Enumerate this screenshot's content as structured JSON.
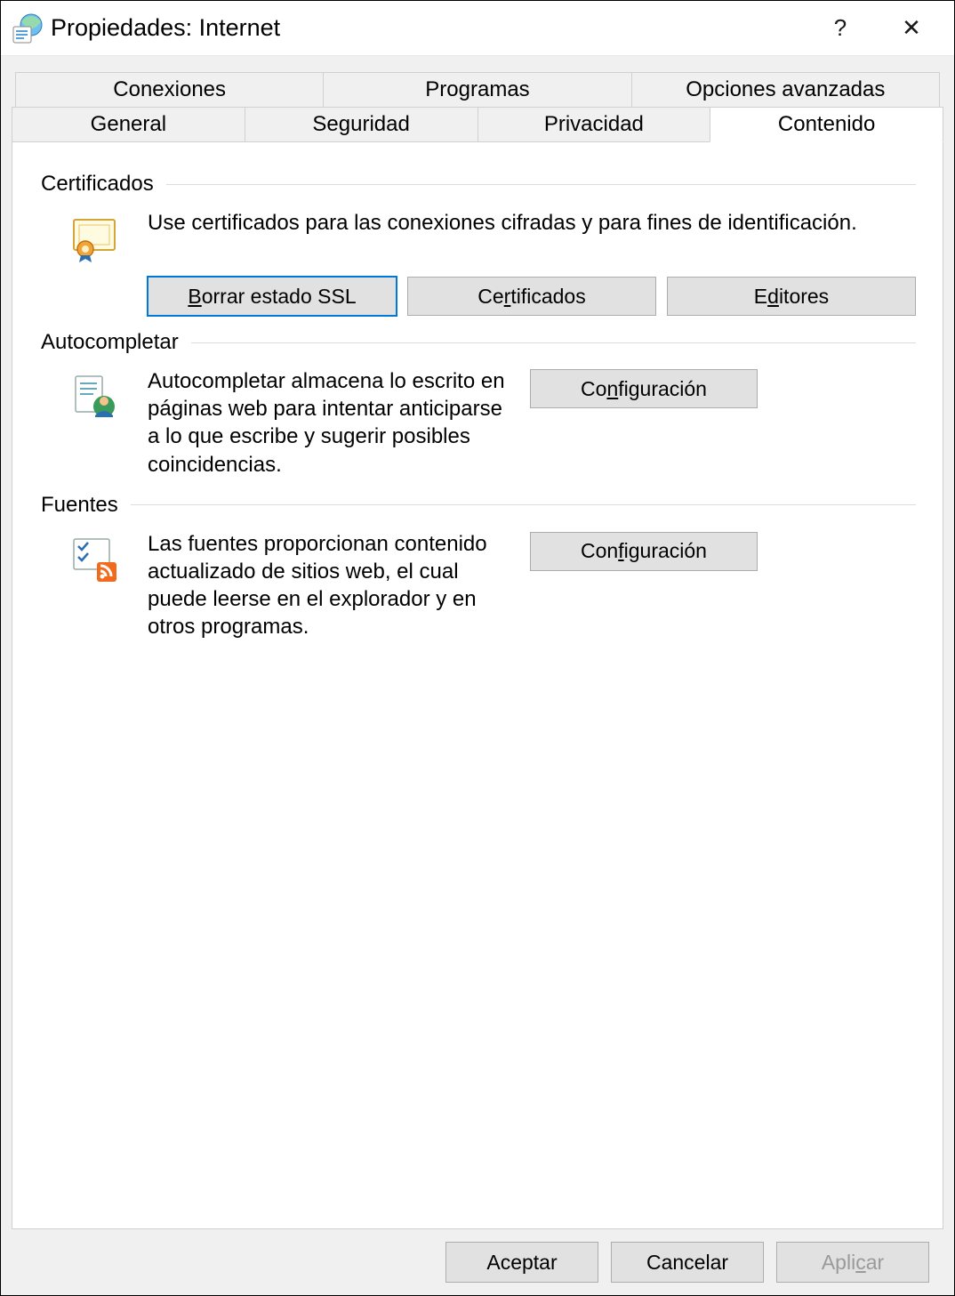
{
  "window": {
    "title": "Propiedades: Internet",
    "help_symbol": "?",
    "close_symbol": "✕"
  },
  "tabs": {
    "row_top": [
      "Conexiones",
      "Programas",
      "Opciones avanzadas"
    ],
    "row_bottom": [
      "General",
      "Seguridad",
      "Privacidad",
      "Contenido"
    ],
    "active": "Contenido"
  },
  "sections": {
    "certificates": {
      "title": "Certificados",
      "description": "Use certificados para las conexiones cifradas y para fines de identificación.",
      "buttons": {
        "clear_ssl_pre": "B",
        "clear_ssl_rest": "orrar estado SSL",
        "certificates_pre": "Ce",
        "certificates_mid": "r",
        "certificates_post": "tificados",
        "editors_pre": "E",
        "editors_mid": "d",
        "editors_post": "itores"
      }
    },
    "autocomplete": {
      "title": "Autocompletar",
      "description": "Autocompletar almacena lo escrito en páginas web para intentar anticiparse a lo que escribe y sugerir posibles coincidencias.",
      "button_pre": "Co",
      "button_mid": "n",
      "button_post": "figuración"
    },
    "feeds": {
      "title": "Fuentes",
      "description": "Las fuentes proporcionan contenido actualizado de sitios web, el cual puede leerse en el explorador y en otros programas.",
      "button_pre": "Con",
      "button_mid": "f",
      "button_post": "iguración"
    }
  },
  "footer": {
    "ok": "Aceptar",
    "cancel": "Cancelar",
    "apply_pre": "Apli",
    "apply_mid": "c",
    "apply_post": "ar"
  }
}
